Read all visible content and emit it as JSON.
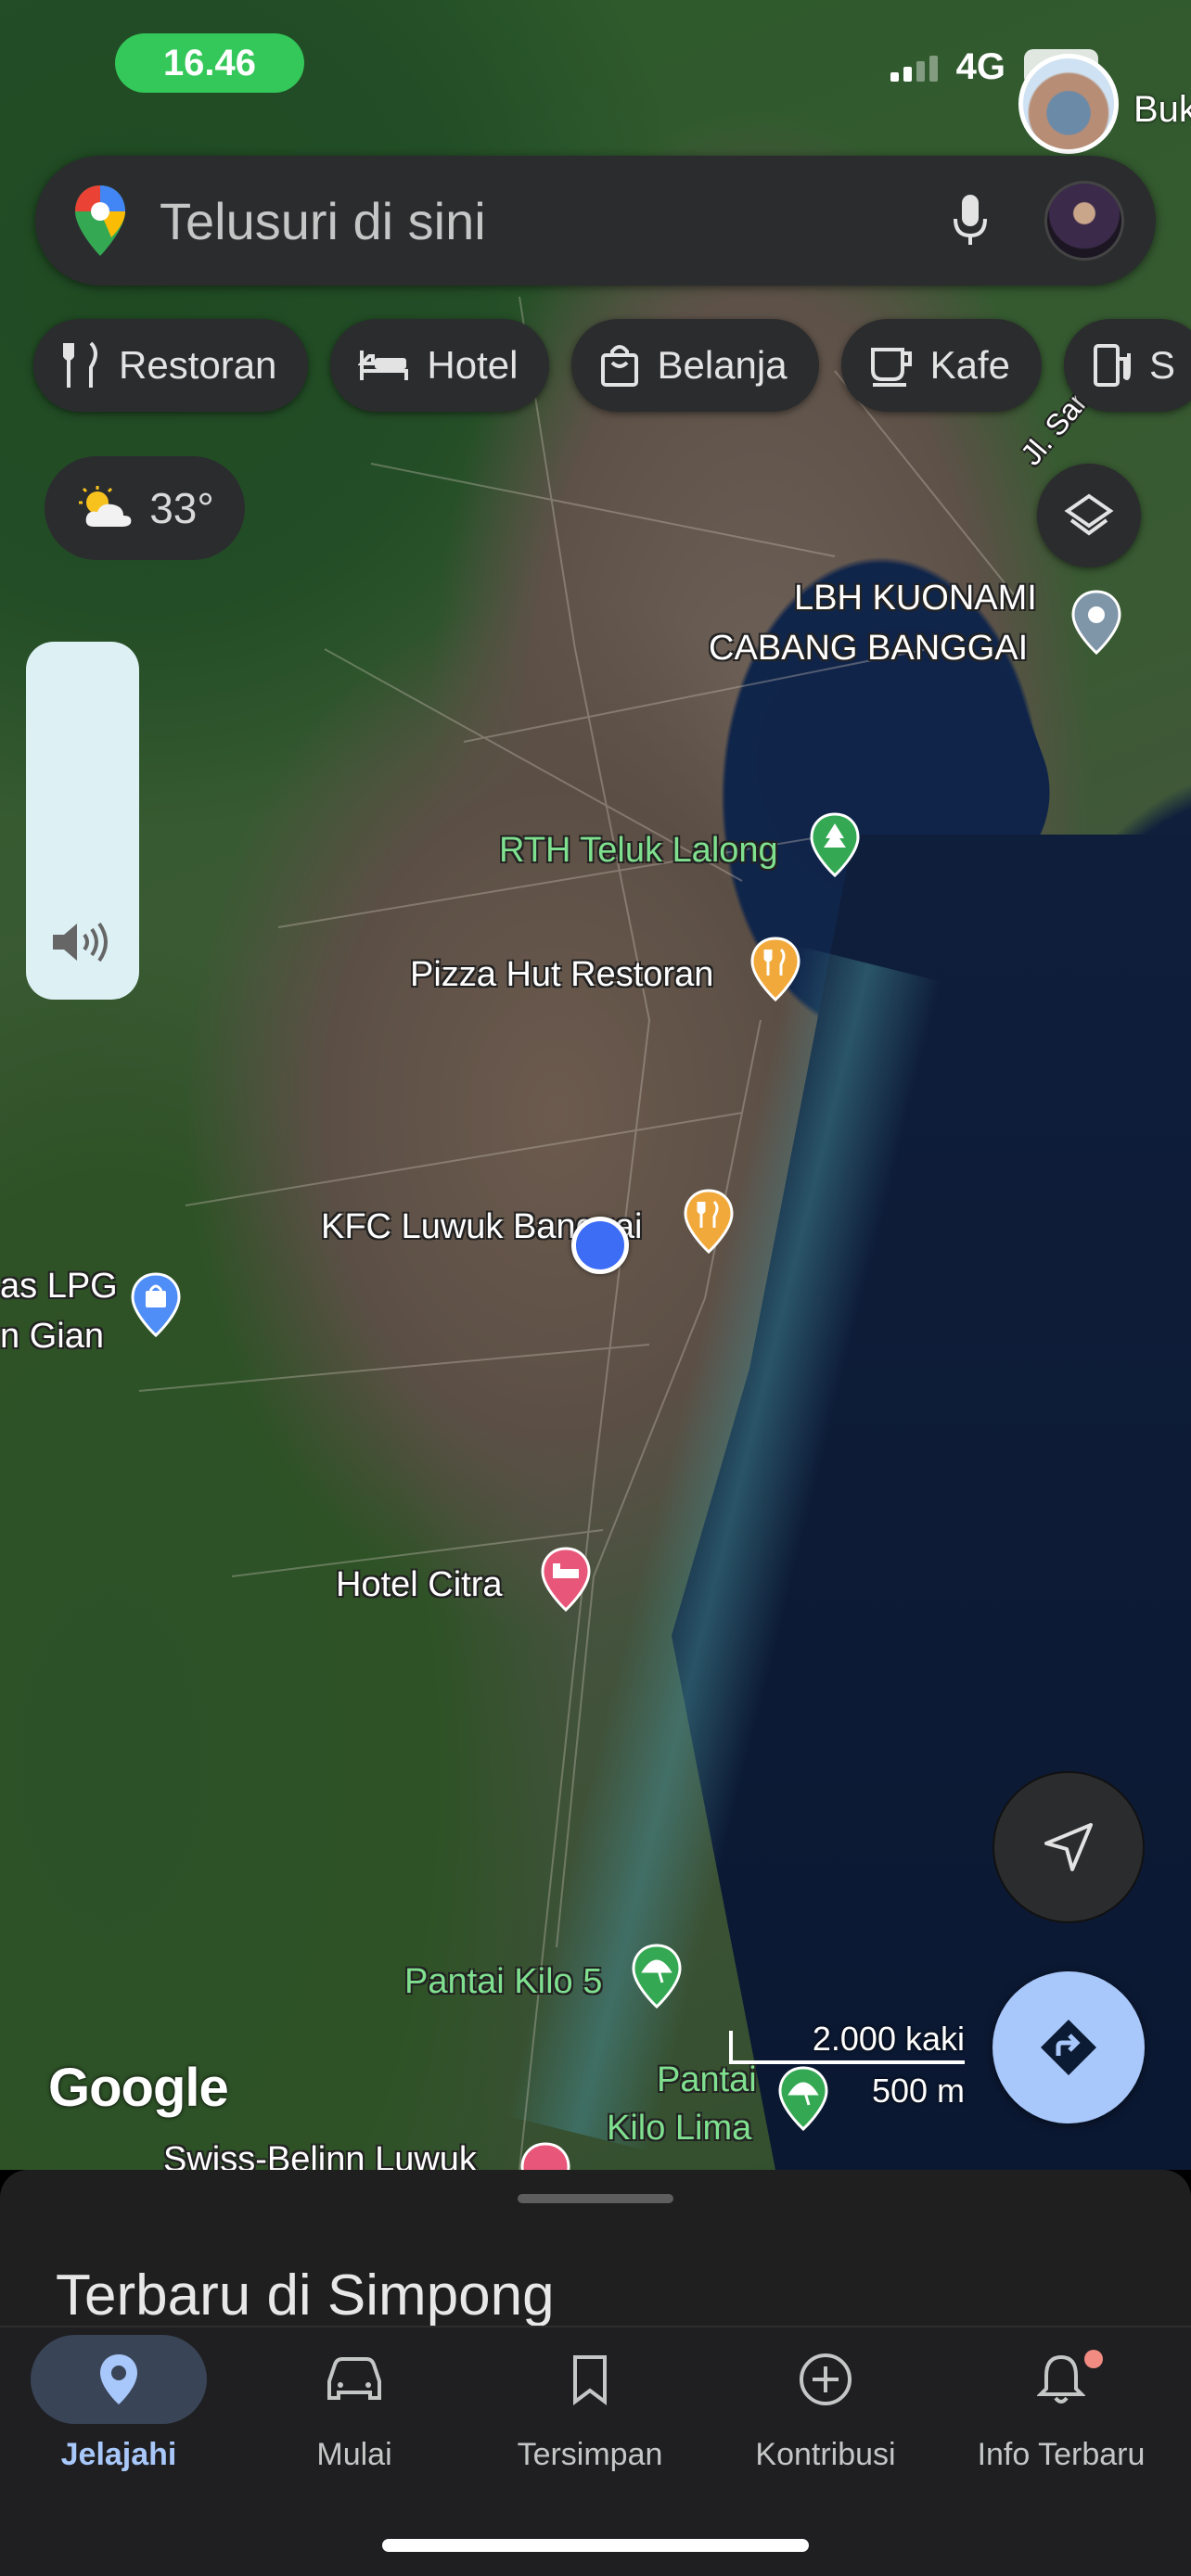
{
  "status_bar": {
    "time": "16.46",
    "network": "4G",
    "battery": "45"
  },
  "search": {
    "placeholder": "Telusuri di sini",
    "icons": [
      "google-maps-pin-icon",
      "mic-icon",
      "avatar"
    ]
  },
  "chips": [
    {
      "label": "Restoran",
      "icon": "fork-knife-icon"
    },
    {
      "label": "Hotel",
      "icon": "bed-icon"
    },
    {
      "label": "Belanja",
      "icon": "shopping-bag-icon"
    },
    {
      "label": "Kafe",
      "icon": "coffee-cup-icon"
    },
    {
      "label": "S",
      "icon": "gas-station-icon"
    }
  ],
  "weather": {
    "temperature": "33°",
    "icon": "partly-cloudy-icon"
  },
  "map": {
    "top_right_place": "Buk",
    "labels": {
      "lbh_line1": "LBH KUONAMI",
      "lbh_line2": "CABANG BANGGAI",
      "jl_samratulangi": "Jl. Samratt",
      "rth": "RTH Teluk Lalong",
      "pizza": "Pizza Hut Restoran",
      "kfc": "KFC Luwuk Banggai",
      "lpg_line1": "as LPG",
      "lpg_line2": "n Gian",
      "hotel_citra": "Hotel Citra",
      "pantai_kilo5": "Pantai Kilo 5",
      "pantai_kilolima_line1": "Pantai",
      "pantai_kilolima_line2": "Kilo Lima",
      "swiss_belinn": "Swiss-Belinn Luwuk"
    },
    "google_logo": "Google",
    "scale": {
      "imperial": "2.000 kaki",
      "metric": "500 m"
    }
  },
  "sheet": {
    "title": "Terbaru di Simpong"
  },
  "nav": [
    {
      "label": "Jelajahi",
      "icon": "location-pin-icon",
      "active": true
    },
    {
      "label": "Mulai",
      "icon": "car-icon",
      "active": false
    },
    {
      "label": "Tersimpan",
      "icon": "bookmark-icon",
      "active": false
    },
    {
      "label": "Kontribusi",
      "icon": "add-circle-icon",
      "active": false
    },
    {
      "label": "Info Terbaru",
      "icon": "bell-icon",
      "active": false,
      "badge": true
    }
  ],
  "colors": {
    "accent": "#a8c7fa",
    "status_green": "#34c759",
    "location_blue": "#3d6cf5",
    "food_pin": "#f2a93b",
    "park_pin": "#34a853",
    "hotel_pin": "#e8577a"
  }
}
